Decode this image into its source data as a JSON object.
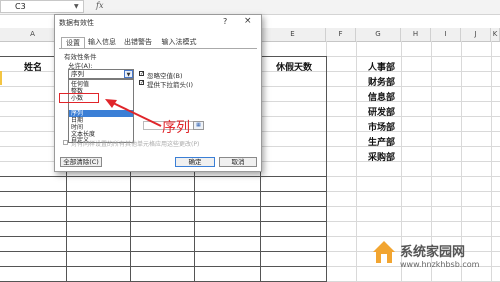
{
  "excel": {
    "name_box": "C3",
    "fx": "fx",
    "columns": [
      "A",
      "B",
      "C",
      "D",
      "E",
      "F",
      "G",
      "H",
      "I",
      "J",
      "K"
    ],
    "table_headers": {
      "name": "姓名",
      "leave_days": "休假天数"
    },
    "departments": [
      "人事部",
      "财务部",
      "信息部",
      "研发部",
      "市场部",
      "生产部",
      "采购部"
    ]
  },
  "dialog": {
    "title": "数据有效性",
    "help": "?",
    "close": "×",
    "tabs": [
      "设置",
      "输入信息",
      "出错警告",
      "输入法模式"
    ],
    "criteria_label": "有效性条件",
    "allow_label": "允许(A):",
    "allow_value": "序列",
    "options": [
      "任何值",
      "整数",
      "小数",
      "序列",
      "日期",
      "时间",
      "文本长度",
      "自定义"
    ],
    "selected_option": "序列",
    "ignore_blank": "忽略空值(B)",
    "in_cell_dropdown": "提供下拉箭头(I)",
    "apply_all": "对有同样设置的所有其他单元格应用这些更改(P)",
    "clear_all_button": "全部清除(C)",
    "ok_button": "确定",
    "cancel_button": "取消"
  },
  "annotation": {
    "text": "序列",
    "color": "#e0252a"
  },
  "watermark": {
    "brand": "系统家园网",
    "url": "www.hnzkhbsb.com"
  }
}
